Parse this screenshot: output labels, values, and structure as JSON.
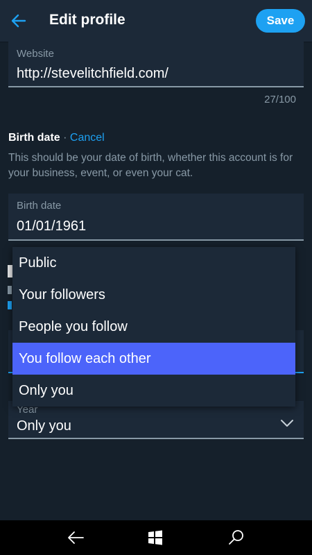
{
  "header": {
    "title": "Edit profile",
    "save_label": "Save"
  },
  "website": {
    "label": "Website",
    "value": "http://stevelitchfield.com/",
    "counter": "27/100"
  },
  "birth": {
    "section_title": "Birth date",
    "separator": " · ",
    "cancel_label": "Cancel",
    "description": "This should be your date of birth, whether this account is for your business, event, or even your cat.",
    "field_label": "Birth date",
    "field_value": "01/01/1961"
  },
  "year_field": {
    "label": "Year",
    "value": "Only you"
  },
  "visibility_dropdown": {
    "options": [
      "Public",
      "Your followers",
      "People you follow",
      "You follow each other",
      "Only you"
    ],
    "highlighted": "You follow each other"
  },
  "colors": {
    "accent": "#1da1f2",
    "selection": "#4c64fa",
    "background": "#15202b",
    "surface": "#1c2938",
    "muted": "#8899a6"
  },
  "icons": {
    "back": "arrow-left-icon",
    "chevron": "chevron-down-icon",
    "nav_back": "nav-back-icon",
    "nav_home": "windows-icon",
    "nav_search": "search-icon"
  }
}
